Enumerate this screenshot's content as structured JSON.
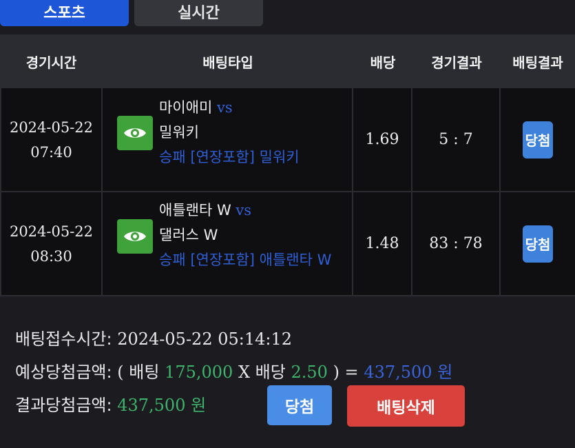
{
  "tabs": {
    "sports": "스포츠",
    "live": "실시간"
  },
  "table": {
    "headers": {
      "time": "경기시간",
      "bet_type": "배팅타입",
      "odds": "배당",
      "game_result": "경기결과",
      "bet_result": "배팅결과"
    },
    "rows": [
      {
        "date": "2024-05-22",
        "time": "07:40",
        "team1": "마이애미",
        "vs": "vs",
        "team2": "밀워키",
        "pick": "승패 [연장포함] 밀워키",
        "odds": "1.69",
        "score": "5 : 7",
        "result": "당첨"
      },
      {
        "date": "2024-05-22",
        "time": "08:30",
        "team1": "애틀랜타 W",
        "vs": "vs",
        "team2": "댈러스 W",
        "pick": "승패 [연장포함] 애틀랜타 W",
        "odds": "1.48",
        "score": "83 : 78",
        "result": "당첨"
      }
    ]
  },
  "summary": {
    "received_label": "배팅접수시간:",
    "received_value": "2024-05-22 05:14:12",
    "expected_label": "예상당첨금액:",
    "open_paren": "(",
    "bet_label": "배팅",
    "bet_amount": "175,000",
    "times": "X",
    "odds_label": "배당",
    "total_odds": "2.50",
    "close_eq": ") =",
    "expected_amount": "437,500 원",
    "result_label": "결과당첨금액:",
    "result_amount": "437,500 원"
  },
  "buttons": {
    "win": "당첨",
    "delete": "배팅삭제"
  },
  "colors": {
    "green": "#3db36b",
    "blue": "#3a64dc",
    "win_badge": "#3e82dc",
    "delete": "#d9413c",
    "eye": "#3fa23a"
  },
  "icons": {
    "view": "eye-icon"
  }
}
